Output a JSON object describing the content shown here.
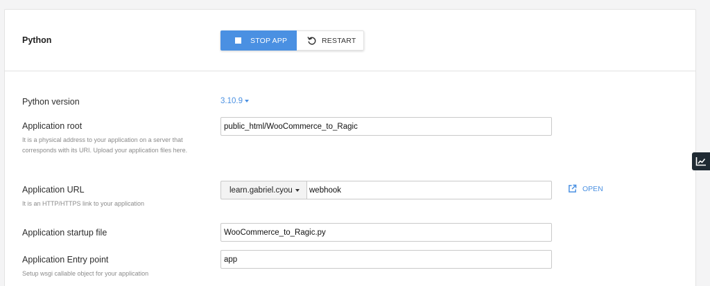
{
  "header": {
    "app_name": "Python",
    "stop_label": "STOP APP",
    "restart_label": "RESTART"
  },
  "fields": {
    "python_version": {
      "label": "Python version",
      "value": "3.10.9"
    },
    "app_root": {
      "label": "Application root",
      "help": "It is a physical address to your application on a server that corresponds with its URI. Upload your application files here.",
      "value": "public_html/WooCommerce_to_Ragic"
    },
    "app_url": {
      "label": "Application URL",
      "help": "It is an HTTP/HTTPS link to your application",
      "domain": "learn.gabriel.cyou",
      "path": "webhook",
      "open_label": "OPEN"
    },
    "startup_file": {
      "label": "Application startup file",
      "value": "WooCommerce_to_Ragic.py"
    },
    "entry_point": {
      "label": "Application Entry point",
      "help": "Setup wsgi callable object for your application",
      "value": "app"
    }
  },
  "icons": {
    "stop": "stop-square-icon",
    "restart": "restart-icon",
    "open": "external-link-icon",
    "side_widget": "chart-trend-icon"
  },
  "colors": {
    "accent": "#4a90e2",
    "side_widget_bg": "#1f2a33"
  }
}
